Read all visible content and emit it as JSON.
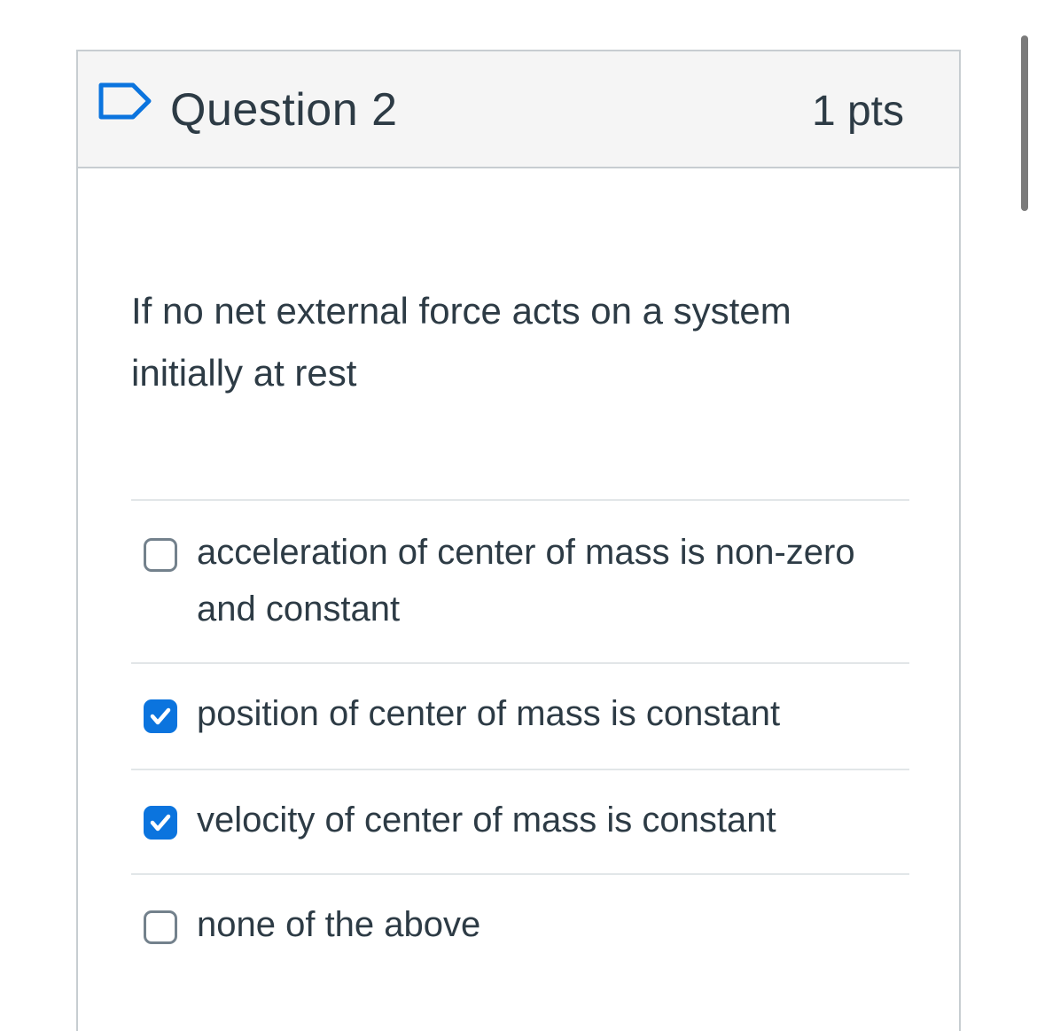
{
  "question": {
    "title": "Question 2",
    "points": "1 pts",
    "flag_icon": "flag-outline-icon",
    "text": "If no net external force acts on a system initially at rest"
  },
  "answers": [
    {
      "label": "acceleration of center of mass is non-zero and constant",
      "checked": false
    },
    {
      "label": "position of center of mass is constant",
      "checked": true
    },
    {
      "label": "velocity of center of mass is constant",
      "checked": true
    },
    {
      "label": "none of the above",
      "checked": false
    }
  ],
  "colors": {
    "accent": "#0b74de",
    "text": "#2d3b45",
    "header_bg": "#f5f5f5",
    "border": "#c7cdd1"
  }
}
